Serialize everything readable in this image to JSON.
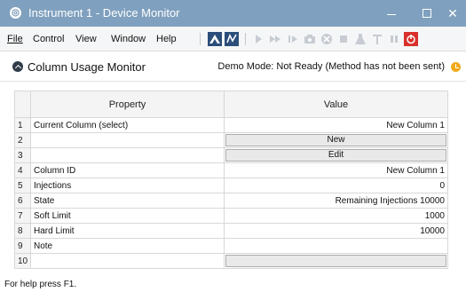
{
  "window": {
    "title": "Instrument 1 - Device Monitor",
    "colors": {
      "titlebar": "#7fa0be",
      "run_icon": "#d9302b",
      "status_icon": "#f0a91a"
    }
  },
  "menu": [
    {
      "key": "file",
      "label": "File"
    },
    {
      "key": "control",
      "label": "Control"
    },
    {
      "key": "view",
      "label": "View"
    },
    {
      "key": "window",
      "label": "Window"
    },
    {
      "key": "help",
      "label": "Help"
    }
  ],
  "panel": {
    "title": "Column Usage Monitor",
    "status": "Demo Mode: Not Ready (Method has not been sent)"
  },
  "grid": {
    "headers": {
      "property": "Property",
      "value": "Value"
    },
    "rows": [
      {
        "num": "1",
        "property": "Current Column (select)",
        "value": "New Column 1"
      },
      {
        "num": "2",
        "property": "",
        "button": "New"
      },
      {
        "num": "3",
        "property": "",
        "button": "Edit"
      },
      {
        "num": "4",
        "property": "Column ID",
        "value": "New Column 1"
      },
      {
        "num": "5",
        "property": "Injections",
        "value": "0"
      },
      {
        "num": "6",
        "property": "State",
        "value": "Remaining Injections 10000"
      },
      {
        "num": "7",
        "property": "Soft Limit",
        "value": "1000"
      },
      {
        "num": "8",
        "property": "Hard Limit",
        "value": "10000"
      },
      {
        "num": "9",
        "property": "Note",
        "value": ""
      },
      {
        "num": "10",
        "property": "",
        "button": ""
      }
    ]
  },
  "statusbar": {
    "text": "For help press F1."
  }
}
